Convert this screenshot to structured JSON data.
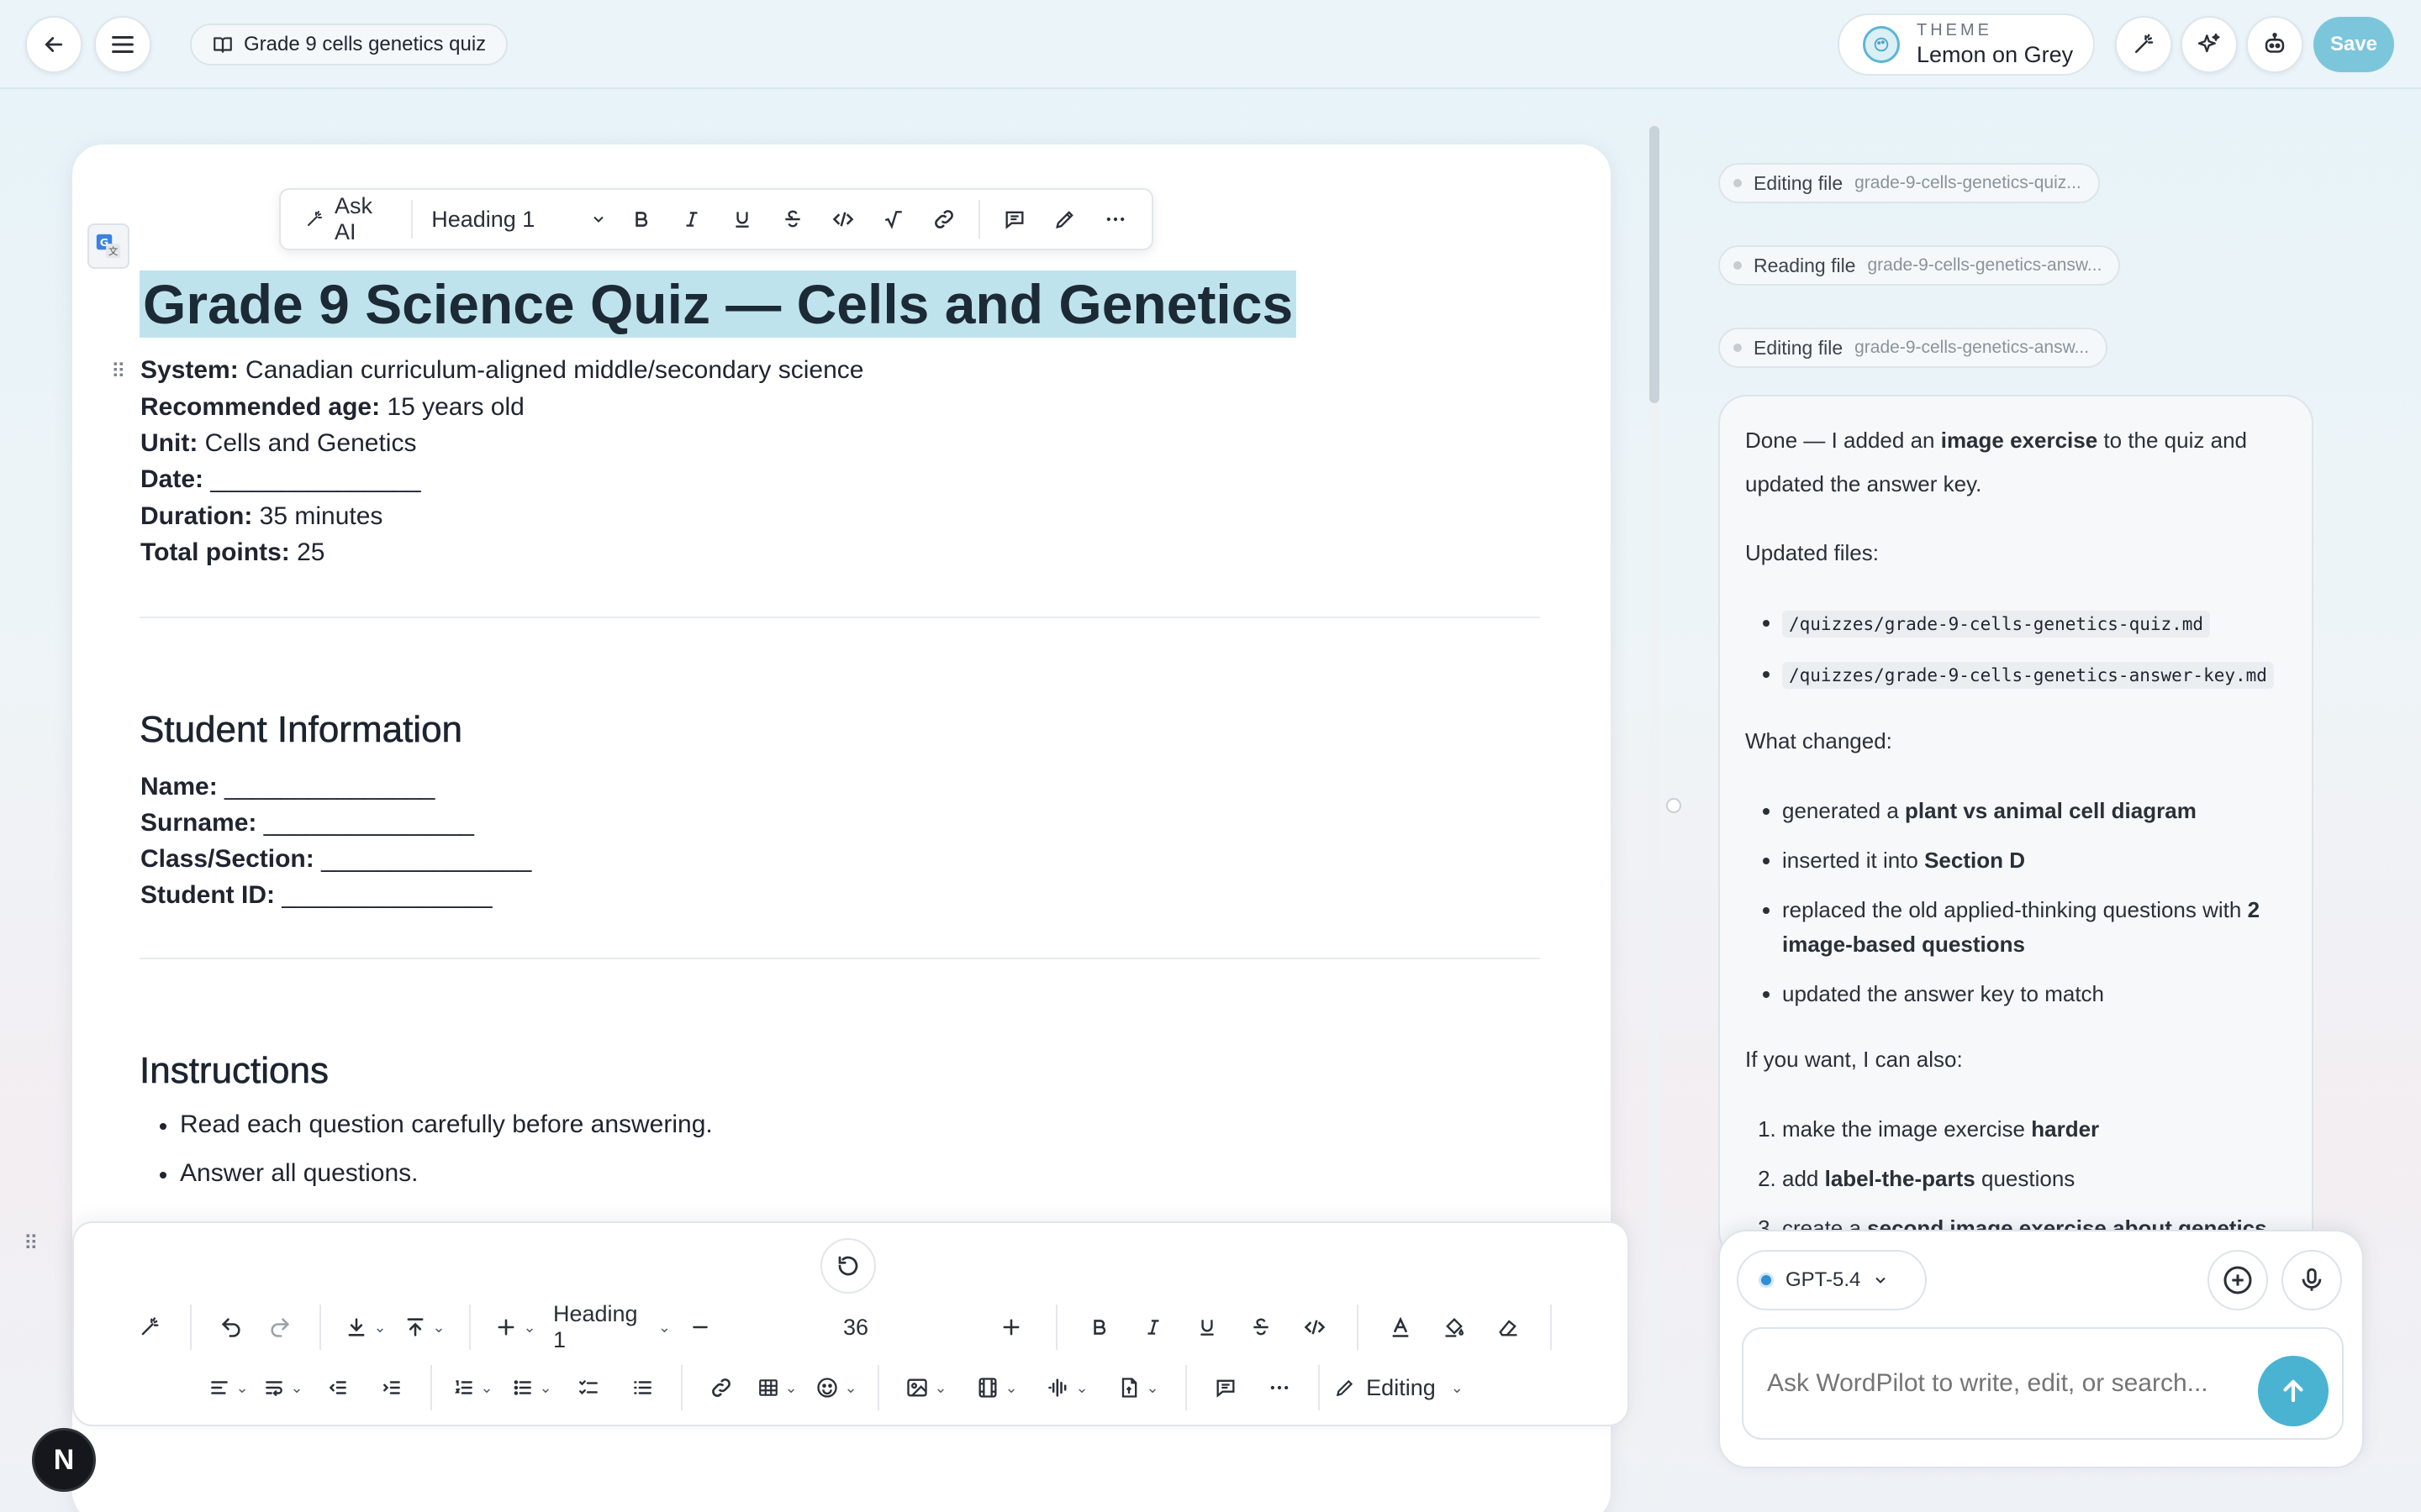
{
  "topbar": {
    "doc_title": "Grade 9 cells genetics quiz",
    "theme_label": "THEME",
    "theme_value": "Lemon on Grey",
    "save_label": "Save"
  },
  "float_toolbar": {
    "ask_ai": "Ask AI",
    "block_type": "Heading 1"
  },
  "document": {
    "title": "Grade 9 Science Quiz — Cells and Genetics",
    "meta": [
      {
        "label": "System:",
        "value": " Canadian curriculum-aligned middle/secondary science"
      },
      {
        "label": "Recommended age:",
        "value": " 15 years old"
      },
      {
        "label": "Unit:",
        "value": " Cells and Genetics"
      },
      {
        "label": "Date:",
        "value": " _______________"
      },
      {
        "label": "Duration:",
        "value": " 35 minutes"
      },
      {
        "label": "Total points:",
        "value": " 25"
      }
    ],
    "student_info_heading": "Student Information",
    "student_fields": [
      {
        "label": "Name:",
        "value": " _______________"
      },
      {
        "label": "Surname:",
        "value": " _______________"
      },
      {
        "label": "Class/Section:",
        "value": " _______________"
      },
      {
        "label": "Student ID:",
        "value": " _______________"
      }
    ],
    "instructions_heading": "Instructions",
    "instructions": [
      "Read each question carefully before answering.",
      "Answer all questions."
    ]
  },
  "bottom_toolbar": {
    "block_type": "Heading 1",
    "font_size": "36",
    "mode": "Editing"
  },
  "chat": {
    "chips": [
      {
        "action": "Editing file",
        "file": "grade-9-cells-genetics-quiz..."
      },
      {
        "action": "Reading file",
        "file": "grade-9-cells-genetics-answ..."
      },
      {
        "action": "Editing file",
        "file": "grade-9-cells-genetics-answ..."
      }
    ],
    "message": {
      "intro_a": "Done — I added an ",
      "intro_b": "image exercise",
      "intro_c": " to the quiz and updated the answer key.",
      "updated_files_label": "Updated files:",
      "files": [
        "/quizzes/grade-9-cells-genetics-quiz.md",
        "/quizzes/grade-9-cells-genetics-answer-key.md"
      ],
      "changed_label": "What changed:",
      "changes": [
        {
          "a": "generated a ",
          "b": "plant vs animal cell diagram",
          "c": ""
        },
        {
          "a": "inserted it into ",
          "b": "Section D",
          "c": ""
        },
        {
          "a": "replaced the old applied-thinking questions with ",
          "b": "2 image-based questions",
          "c": ""
        },
        {
          "a": "updated the answer key to match",
          "b": "",
          "c": ""
        }
      ],
      "offer_label": "If you want, I can also:",
      "offers": [
        {
          "a": "make the image exercise ",
          "b": "harder",
          "c": ""
        },
        {
          "a": "add ",
          "b": "label-the-parts",
          "c": " questions"
        },
        {
          "a": "create a ",
          "b": "second image exercise about genetics",
          "c": ""
        }
      ]
    },
    "model": "GPT-5.4",
    "input_placeholder": "Ask WordPilot to write, edit, or search..."
  },
  "user": {
    "avatar_letter": "N"
  },
  "colors": {
    "accent": "#4bb3d2",
    "title_highlight": "#bfe3ec",
    "save_button": "#7cc6dc"
  }
}
